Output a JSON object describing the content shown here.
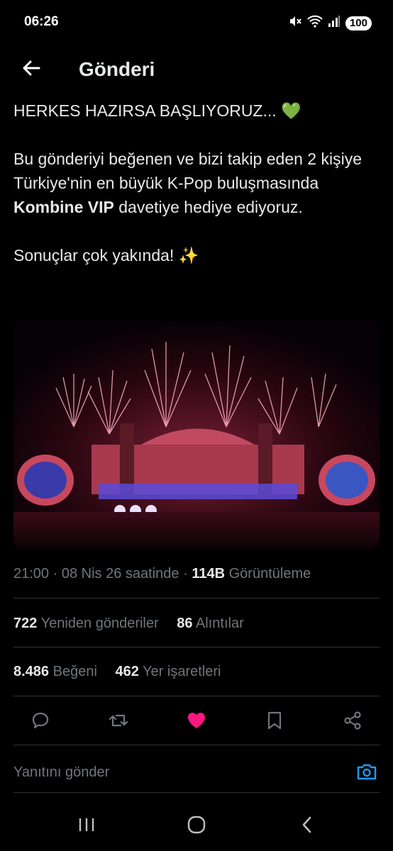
{
  "status_bar": {
    "time": "06:26",
    "battery": "100",
    "icons": [
      "mute-icon",
      "wifi-icon",
      "signal-icon",
      "battery-icon"
    ]
  },
  "header": {
    "title": "Gönderi",
    "back_icon": "arrow-left-icon"
  },
  "post": {
    "line1": "HERKES HAZIRSA BAŞLIYORUZ... 💚",
    "para2_part1": "Bu gönderiyi beğenen ve bizi takip eden 2 kişiye Türkiye'nin en büyük K-Pop buluşmasında ",
    "para2_bold": "Kombine VIP",
    "para2_part2": " davetiye hediye ediyoruz.",
    "line3": "Sonuçlar çok yakında! ✨",
    "media_description_icon": "concert-photo"
  },
  "meta": {
    "time": "21:00",
    "separator": "·",
    "date": "08 Nis 26 saatinde",
    "views_count": "114B",
    "views_label": "Görüntüleme"
  },
  "stats": {
    "reposts_count": "722",
    "reposts_label": "Yeniden gönderiler",
    "quotes_count": "86",
    "quotes_label": "Alıntılar",
    "likes_count": "8.486",
    "likes_label": "Beğeni",
    "bookmarks_count": "462",
    "bookmarks_label": "Yer işaretleri"
  },
  "actions": {
    "icons": [
      "reply-icon",
      "repost-icon",
      "like-icon",
      "bookmark-icon",
      "share-icon"
    ],
    "like_color": "#f91880"
  },
  "reply": {
    "placeholder": "Yanıtını gönder",
    "camera_color": "#1d9bf0"
  },
  "navbar": {
    "icons": [
      "recent-apps-icon",
      "home-icon",
      "back-icon"
    ]
  }
}
